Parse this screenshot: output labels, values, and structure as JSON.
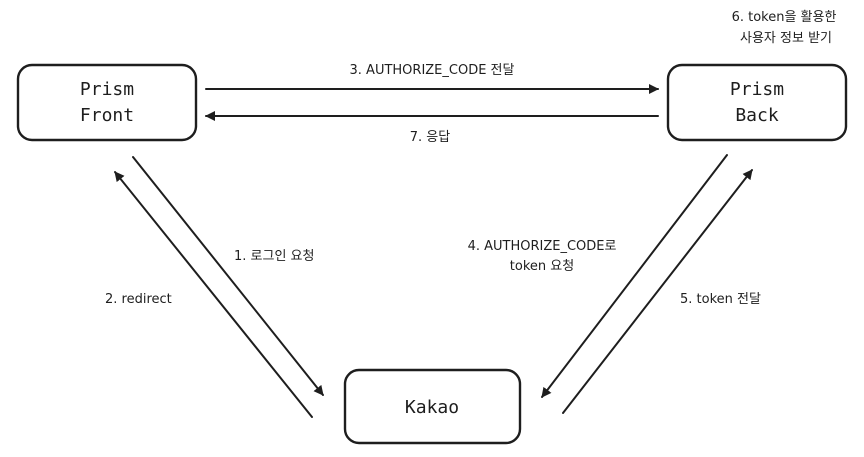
{
  "nodes": {
    "prism_front": {
      "line1": "Prism",
      "line2": "Front"
    },
    "prism_back": {
      "line1": "Prism",
      "line2": "Back"
    },
    "kakao": {
      "label": "Kakao"
    }
  },
  "edges": {
    "e1": "1. 로그인 요청",
    "e2": "2. redirect",
    "e3": "3. AUTHORIZE_CODE 전달",
    "e4_line1": "4. AUTHORIZE_CODE로",
    "e4_line2": "token 요청",
    "e5": "5. token 전달",
    "e6_line1": "6. token을 활용한",
    "e6_line2": "사용자 정보 받기",
    "e7": "7. 응답"
  }
}
